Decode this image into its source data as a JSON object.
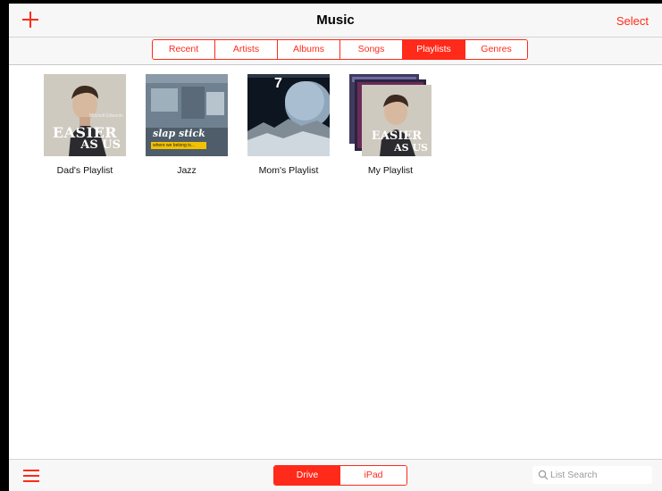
{
  "header": {
    "title": "Music",
    "select_label": "Select",
    "add_icon": "plus-icon"
  },
  "tabs": {
    "items": [
      {
        "label": "Recent"
      },
      {
        "label": "Artists"
      },
      {
        "label": "Albums"
      },
      {
        "label": "Songs"
      },
      {
        "label": "Playlists"
      },
      {
        "label": "Genres"
      }
    ],
    "selected": "Playlists"
  },
  "playlists": [
    {
      "name": "Dad's Playlist",
      "art": {
        "title": "EASIER",
        "subtitle": "AS US",
        "artist": "Mitchell Edwards"
      }
    },
    {
      "name": "Jazz",
      "art": {
        "title": "slap stick",
        "subtitle": "where we belong is..."
      }
    },
    {
      "name": "Mom's Playlist",
      "art": {
        "number": "7"
      }
    },
    {
      "name": "My Playlist",
      "art": {
        "title": "EASIER",
        "subtitle": "AS US"
      }
    }
  ],
  "bottom": {
    "menu_icon": "hamburger-menu-icon",
    "source_toggle": [
      {
        "label": "Drive",
        "active": true
      },
      {
        "label": "iPad",
        "active": false
      }
    ],
    "search_placeholder": "List Search",
    "search_icon": "search-icon"
  },
  "colors": {
    "accent": "#ff2a1a",
    "bar_background": "#f7f7f7"
  }
}
